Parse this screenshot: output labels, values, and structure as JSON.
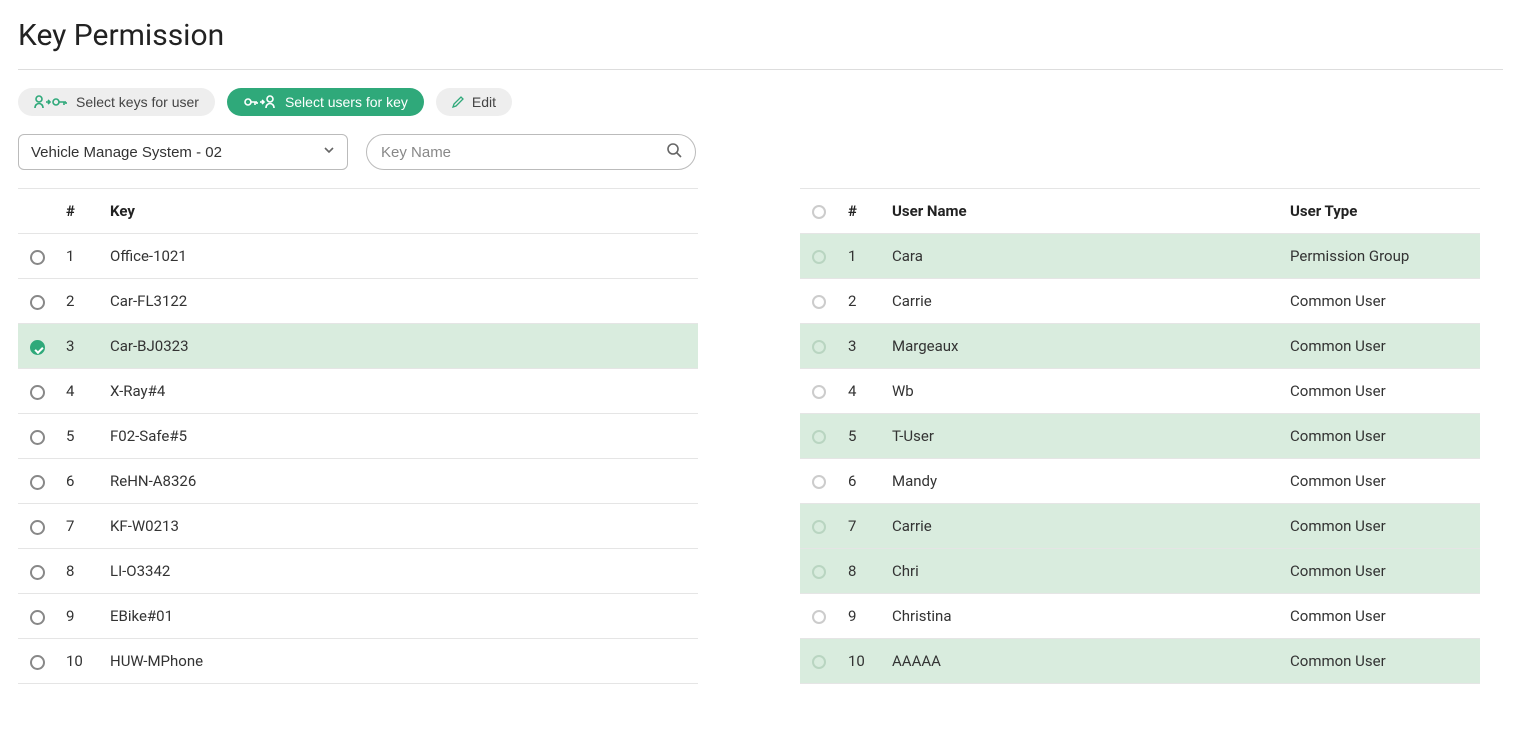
{
  "page": {
    "title": "Key Permission"
  },
  "toolbar": {
    "select_keys_label": "Select keys for user",
    "select_users_label": "Select users for key",
    "edit_label": "Edit"
  },
  "filters": {
    "system_selected": "Vehicle Manage System - 02",
    "search_placeholder": "Key Name"
  },
  "keys_table": {
    "headers": {
      "num": "#",
      "key": "Key"
    },
    "selected_index": 2,
    "rows": [
      {
        "num": "1",
        "key": "Office-1021"
      },
      {
        "num": "2",
        "key": "Car-FL3122"
      },
      {
        "num": "3",
        "key": "Car-BJ0323"
      },
      {
        "num": "4",
        "key": "X-Ray#4"
      },
      {
        "num": "5",
        "key": "F02-Safe#5"
      },
      {
        "num": "6",
        "key": "ReHN-A8326"
      },
      {
        "num": "7",
        "key": "KF-W0213"
      },
      {
        "num": "8",
        "key": "LI-O3342"
      },
      {
        "num": "9",
        "key": "EBike#01"
      },
      {
        "num": "10",
        "key": "HUW-MPhone"
      }
    ]
  },
  "users_table": {
    "headers": {
      "num": "#",
      "user_name": "User Name",
      "user_type": "User Type"
    },
    "rows": [
      {
        "num": "1",
        "name": "Cara",
        "type": "Permission Group",
        "alt": true
      },
      {
        "num": "2",
        "name": "Carrie",
        "type": "Common User",
        "alt": false
      },
      {
        "num": "3",
        "name": "Margeaux",
        "type": "Common User",
        "alt": true
      },
      {
        "num": "4",
        "name": "Wb",
        "type": "Common User",
        "alt": false
      },
      {
        "num": "5",
        "name": "T-User",
        "type": "Common User",
        "alt": true
      },
      {
        "num": "6",
        "name": "Mandy",
        "type": "Common User",
        "alt": false
      },
      {
        "num": "7",
        "name": "Carrie",
        "type": "Common User",
        "alt": true
      },
      {
        "num": "8",
        "name": "Chri",
        "type": "Common User",
        "alt": true
      },
      {
        "num": "9",
        "name": "Christina",
        "type": "Common User",
        "alt": false
      },
      {
        "num": "10",
        "name": "AAAAA",
        "type": "Common User",
        "alt": true
      }
    ]
  }
}
